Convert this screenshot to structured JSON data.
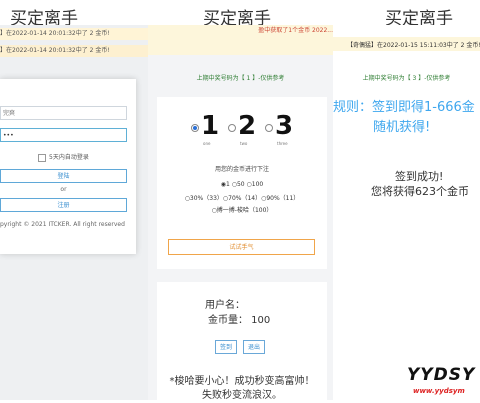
{
  "headings": [
    "买定离手",
    "买定离手",
    "买定离手"
  ],
  "left": {
    "notice1": "】在2022-01-14 20:01:32中了 2 金币!",
    "notice2": "】在2022-01-14 20:01:32中了 2 金币!",
    "username_value": "完爽",
    "password_value": "•••",
    "remember_label": "5天内自动登录",
    "login_label": "登陆",
    "or_label": "or",
    "register_label": "注册",
    "copyright": "pyright © 2021 ITCKER. All right reserved"
  },
  "middle": {
    "top_notice": "盈中获取了1个金币 2022...",
    "info": "上期中奖号码为【 1 】-仅供参考",
    "numbers": [
      {
        "digit": "1",
        "sub": "one",
        "selected": true
      },
      {
        "digit": "2",
        "sub": "two",
        "selected": false
      },
      {
        "digit": "3",
        "sub": "three",
        "selected": false
      }
    ],
    "bet_label": "用您的金币进行下注",
    "bet_options": "◉1 ○50 ○100",
    "rate_options": "○30%（33）○70%（14）○90%（11）",
    "extra_option": "○搏一搏-梭哈（100）",
    "try_label": "试试手气",
    "user_line": "用户名：",
    "coin_line": "金币量：  100",
    "checkin_label": "签到",
    "logout_label": "退出",
    "warn1": "*梭哈要小心！成功秒变高富帅！",
    "warn2": "失败秒变流浪汉。"
  },
  "right": {
    "notice": "【奇偶猛】在2022-01-15 15:11:03中了 2 金币!",
    "info": "上期中奖号码为【 3 】-仅供参考",
    "rule1": "规则：签到即得1-666金",
    "rule2": "随机获得!",
    "result1": "签到成功!",
    "result2": "您将获得623个金币",
    "watermark_logo": "YYDSY",
    "watermark_url": "www.yydsym"
  }
}
